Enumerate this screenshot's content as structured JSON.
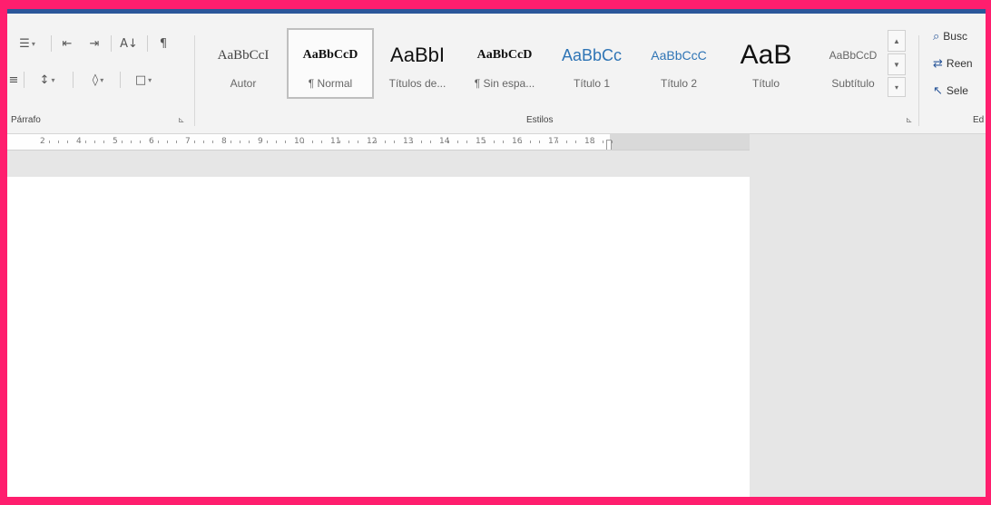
{
  "paragraph_group": {
    "label": "Párrafo",
    "launcher": "⊾",
    "row1": [
      {
        "icon": "bullet-list-icon",
        "glyph": "☰",
        "drop": "▾"
      },
      {
        "icon": "decrease-indent-icon",
        "glyph": "⇤"
      },
      {
        "icon": "increase-indent-icon",
        "glyph": "⇥"
      },
      {
        "icon": "sort-icon",
        "glyph": "A↓"
      },
      {
        "icon": "pilcrow-icon",
        "glyph": "¶"
      }
    ],
    "row2": [
      {
        "icon": "justify-icon",
        "glyph": "≡"
      },
      {
        "icon": "line-spacing-icon",
        "glyph": "↕",
        "drop": "▾"
      },
      {
        "icon": "shading-icon",
        "glyph": "◊",
        "drop": "▾"
      },
      {
        "icon": "borders-icon",
        "glyph": "□",
        "drop": "▾"
      }
    ]
  },
  "styles_group": {
    "label": "Estilos",
    "launcher": "⊾",
    "tiles": [
      {
        "sample": "AaBbCcI",
        "name": "Autor",
        "font": "serif",
        "size": 15,
        "color": "#444444",
        "weight": "normal",
        "selected": false
      },
      {
        "sample": "AaBbCcD",
        "name": "¶ Normal",
        "font": "serif",
        "size": 14,
        "color": "#111111",
        "weight": "bold",
        "selected": true
      },
      {
        "sample": "AaBbI",
        "name": "Títulos de...",
        "font": "sans",
        "size": 22,
        "color": "#111111",
        "weight": "normal",
        "selected": false
      },
      {
        "sample": "AaBbCcD",
        "name": "¶ Sin espa...",
        "font": "serif",
        "size": 14,
        "color": "#111111",
        "weight": "bold",
        "selected": false
      },
      {
        "sample": "AaBbCc",
        "name": "Título 1",
        "font": "sans",
        "size": 18,
        "color": "#2e74b5",
        "weight": "normal",
        "selected": false
      },
      {
        "sample": "AaBbCcC",
        "name": "Título 2",
        "font": "sans",
        "size": 14,
        "color": "#2e74b5",
        "weight": "normal",
        "selected": false
      },
      {
        "sample": "AaB",
        "name": "Título",
        "font": "sans",
        "size": 30,
        "color": "#111111",
        "weight": "normal",
        "selected": false
      },
      {
        "sample": "AaBbCcD",
        "name": "Subtítulo",
        "font": "sans",
        "size": 12,
        "color": "#666666",
        "weight": "normal",
        "selected": false
      }
    ],
    "scroll_up": "▲",
    "scroll_down": "▼",
    "more": "▾"
  },
  "editing_group": {
    "label": "Ed",
    "find": "Busc",
    "replace": "Reen",
    "select": "Sele"
  },
  "ruler": {
    "numbers": [
      "2",
      "4",
      "5",
      "6",
      "7",
      "8",
      "9",
      "10",
      "11",
      "12",
      "13",
      "14",
      "15",
      "16",
      "17",
      "18"
    ]
  },
  "colors": {
    "accent": "#2b579a",
    "frame": "#ff1e6e"
  }
}
